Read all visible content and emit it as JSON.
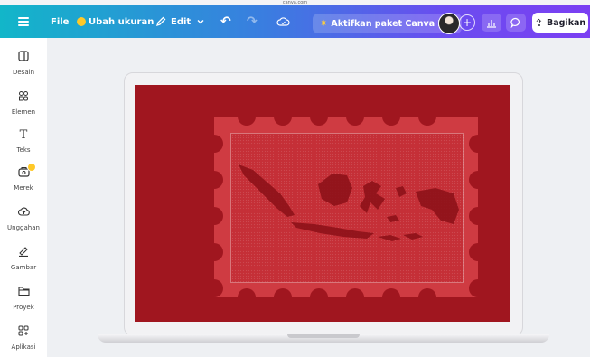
{
  "browser": {
    "url": "canva.com"
  },
  "toolbar": {
    "file_label": "File",
    "resize_label": "Ubah ukuran",
    "edit_label": "Edit",
    "pro_label": "Aktifkan paket Canva Pro",
    "share_label": "Bagikan"
  },
  "sidebar": {
    "items": [
      {
        "label": "Desain",
        "icon": "design-icon"
      },
      {
        "label": "Elemen",
        "icon": "elements-icon"
      },
      {
        "label": "Teks",
        "icon": "text-icon"
      },
      {
        "label": "Merek",
        "icon": "brand-icon"
      },
      {
        "label": "Unggahan",
        "icon": "upload-icon"
      },
      {
        "label": "Gambar",
        "icon": "draw-icon"
      },
      {
        "label": "Proyek",
        "icon": "folder-icon"
      },
      {
        "label": "Aplikasi",
        "icon": "apps-icon"
      }
    ]
  },
  "colors": {
    "accent_start": "#12b6c9",
    "accent_end": "#7b3ff2",
    "canvas_bg": "#a0161f",
    "stamp": "#cf3b42"
  }
}
